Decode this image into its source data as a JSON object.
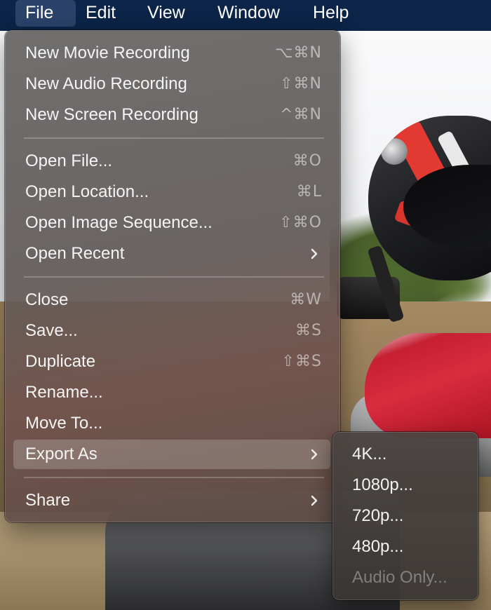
{
  "menubar": {
    "items": [
      "File",
      "Edit",
      "View",
      "Window",
      "Help"
    ],
    "selected": "File",
    "background": "#0b2447"
  },
  "file_menu": {
    "items": [
      {
        "label": "New Movie Recording",
        "shortcut": "⌥⌘N"
      },
      {
        "label": "New Audio Recording",
        "shortcut": "⇧⌘N"
      },
      {
        "label": "New Screen Recording",
        "shortcut": "^⌘N"
      },
      {
        "label": "Open File...",
        "shortcut": "⌘O"
      },
      {
        "label": "Open Location...",
        "shortcut": "⌘L"
      },
      {
        "label": "Open Image Sequence...",
        "shortcut": "⇧⌘O"
      },
      {
        "label": "Open Recent",
        "submenu": true
      },
      {
        "label": "Close",
        "shortcut": "⌘W"
      },
      {
        "label": "Save...",
        "shortcut": "⌘S"
      },
      {
        "label": "Duplicate",
        "shortcut": "⇧⌘S"
      },
      {
        "label": "Rename..."
      },
      {
        "label": "Move To..."
      },
      {
        "label": "Export As",
        "submenu": true,
        "highlighted": true
      },
      {
        "label": "Share",
        "submenu": true
      }
    ]
  },
  "export_submenu": {
    "items": [
      {
        "label": "4K..."
      },
      {
        "label": "1080p..."
      },
      {
        "label": "720p..."
      },
      {
        "label": "480p..."
      },
      {
        "label": "Audio Only...",
        "disabled": true
      }
    ]
  },
  "icons": {
    "submenu_indicator": "chevron-right-icon"
  },
  "colors": {
    "menu_text": "#f4f4f4",
    "shortcut_text": "rgba(255,255,255,0.52)",
    "highlight": "rgba(255,255,255,0.20)",
    "disabled_text": "rgba(255,255,255,0.35)"
  }
}
